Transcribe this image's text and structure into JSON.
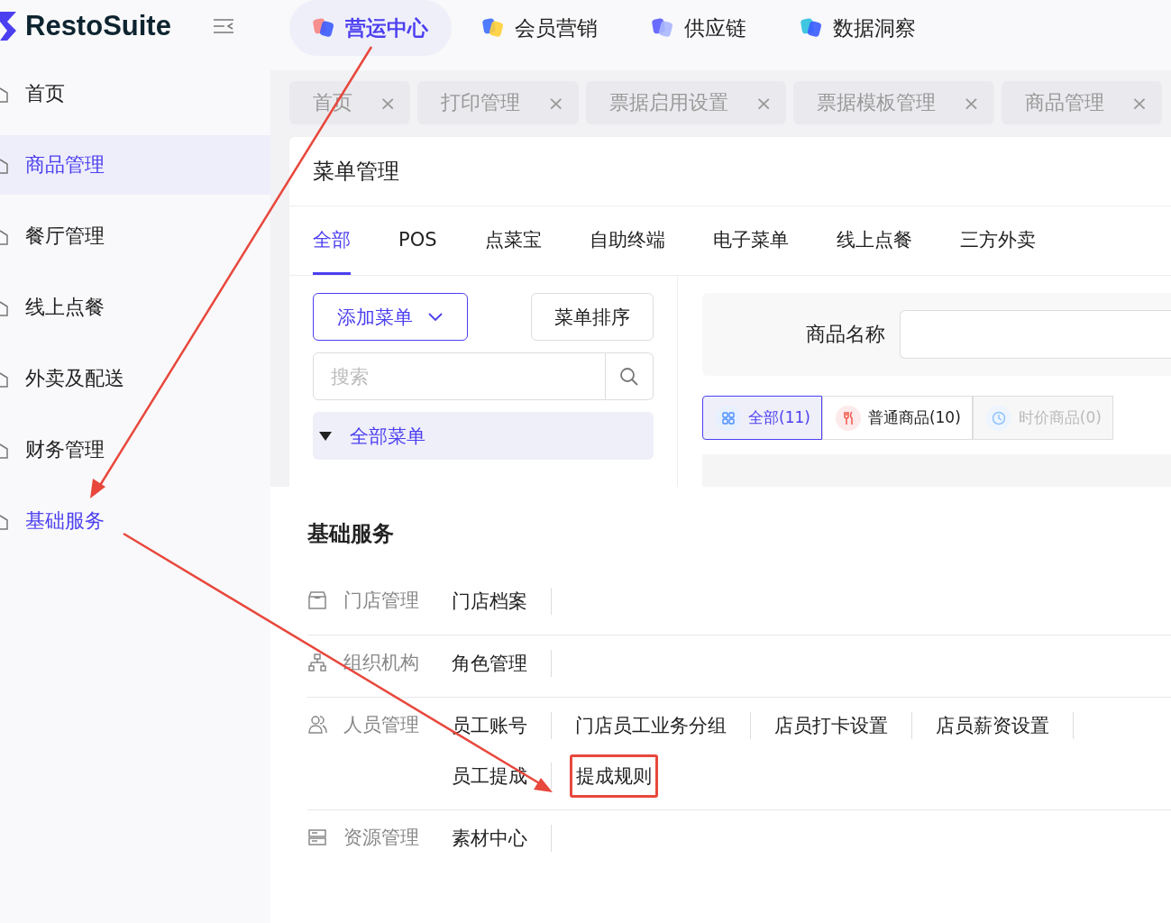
{
  "logo": {
    "text": "RestoSuite"
  },
  "top_nav": [
    {
      "label": "营运中心",
      "selected": true
    },
    {
      "label": "会员营销",
      "selected": false
    },
    {
      "label": "供应链",
      "selected": false
    },
    {
      "label": "数据洞察",
      "selected": false
    }
  ],
  "sidebar": {
    "items": [
      {
        "label": "首页",
        "selected": false,
        "expanded": false
      },
      {
        "label": "商品管理",
        "selected": true,
        "expanded": false
      },
      {
        "label": "餐厅管理",
        "selected": false,
        "expanded": false
      },
      {
        "label": "线上点餐",
        "selected": false,
        "expanded": false
      },
      {
        "label": "外卖及配送",
        "selected": false,
        "expanded": false
      },
      {
        "label": "财务管理",
        "selected": false,
        "expanded": false
      },
      {
        "label": "基础服务",
        "selected": false,
        "expanded": true
      }
    ]
  },
  "page_tabs": [
    {
      "label": "首页",
      "close": "×"
    },
    {
      "label": "打印管理",
      "close": "×"
    },
    {
      "label": "票据启用设置",
      "close": "×"
    },
    {
      "label": "票据模板管理",
      "close": "×"
    },
    {
      "label": "商品管理",
      "close": "×"
    }
  ],
  "card": {
    "title": "菜单管理",
    "channel_tabs": [
      {
        "label": "全部",
        "selected": true
      },
      {
        "label": "POS",
        "selected": false
      },
      {
        "label": "点菜宝",
        "selected": false
      },
      {
        "label": "自助终端",
        "selected": false
      },
      {
        "label": "电子菜单",
        "selected": false
      },
      {
        "label": "线上点餐",
        "selected": false
      },
      {
        "label": "三方外卖",
        "selected": false
      }
    ],
    "add_menu_button": "添加菜单",
    "sort_button": "菜单排序",
    "search": {
      "placeholder": "搜索"
    },
    "tree": [
      {
        "label": "全部菜单",
        "expanded": true,
        "selected": true
      }
    ],
    "filter": {
      "label": "商品名称"
    },
    "type_tabs": [
      {
        "label": "全部(11)",
        "selected": true,
        "disabled": false
      },
      {
        "label": "普通商品(10)",
        "selected": false,
        "disabled": false
      },
      {
        "label": "时价商品(0)",
        "selected": false,
        "disabled": true
      }
    ]
  },
  "popup": {
    "title": "基础服务",
    "groups": [
      {
        "label": "门店管理",
        "links": [
          {
            "text": "门店档案",
            "highlighted": false
          }
        ]
      },
      {
        "label": "组织机构",
        "links": [
          {
            "text": "角色管理",
            "highlighted": false
          }
        ]
      },
      {
        "label": "人员管理",
        "links": [
          {
            "text": "员工账号",
            "highlighted": false
          },
          {
            "text": "门店员工业务分组",
            "highlighted": false
          },
          {
            "text": "店员打卡设置",
            "highlighted": false
          },
          {
            "text": "店员薪资设置",
            "highlighted": false
          },
          {
            "text": "员工提成",
            "highlighted": false
          },
          {
            "text": "提成规则",
            "highlighted": true
          }
        ]
      },
      {
        "label": "资源管理",
        "links": [
          {
            "text": "素材中心",
            "highlighted": false
          }
        ]
      }
    ]
  }
}
